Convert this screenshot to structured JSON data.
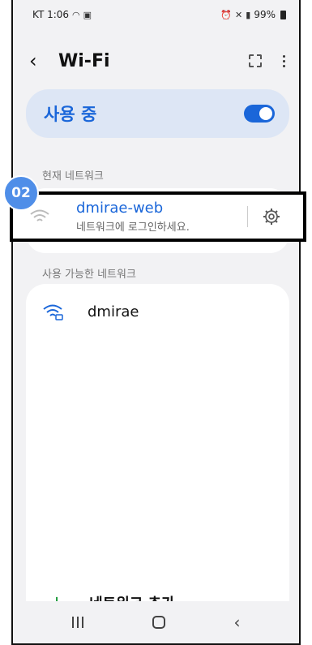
{
  "status_bar": {
    "carrier_time": "KT 1:06",
    "battery": "99%"
  },
  "header": {
    "title": "Wi-Fi"
  },
  "wifi_toggle": {
    "label": "사용 중",
    "state": "on"
  },
  "current_section": {
    "label": "현재 네트워크",
    "network": {
      "name": "dmirae-web",
      "status": "네트워크에 로그인하세요."
    }
  },
  "step_badge": "02",
  "available_section": {
    "label": "사용 가능한 네트워크",
    "networks": [
      {
        "name": "dmirae",
        "secured": true
      }
    ]
  },
  "add_network": {
    "label": "네트워크 추가"
  },
  "icons": {
    "back": "chevron-left-icon",
    "qr": "qr-scan-icon",
    "more": "more-vertical-icon",
    "wifi": "wifi-icon",
    "wifi_lock": "wifi-lock-icon",
    "settings": "gear-icon",
    "add": "plus-icon"
  },
  "colors": {
    "accent": "#1a66d9",
    "badge": "#4f8ee8",
    "add": "#1a9a3a"
  }
}
